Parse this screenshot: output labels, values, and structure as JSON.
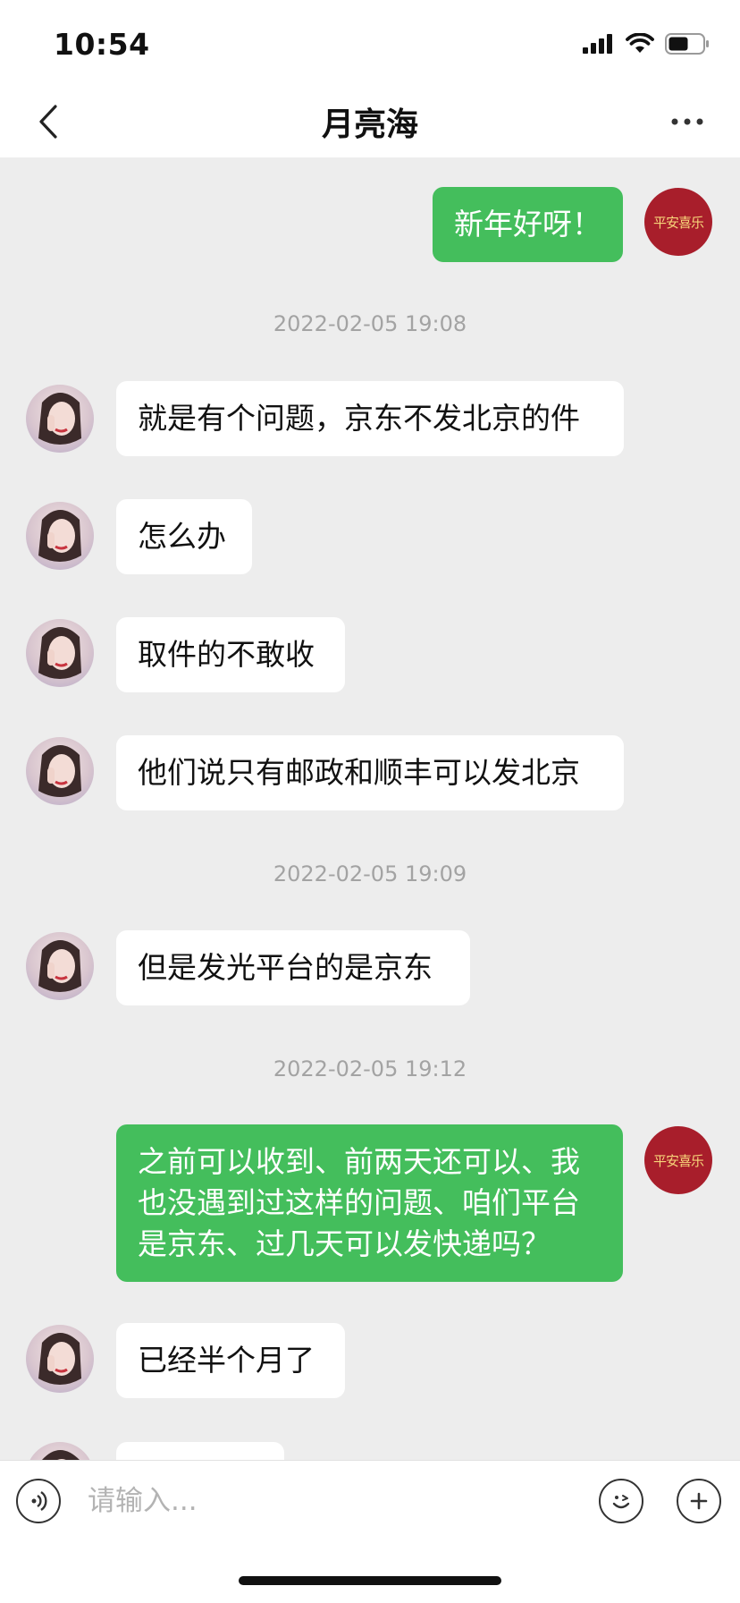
{
  "status_bar": {
    "time": "10:54"
  },
  "header": {
    "title": "月亮海"
  },
  "self_avatar_text": "平安喜乐",
  "messages": [
    {
      "type": "out",
      "text": "新年好呀！"
    },
    {
      "type": "time",
      "text": "2022-02-05 19:08"
    },
    {
      "type": "in",
      "text": "就是有个问题，京东不发北京的件"
    },
    {
      "type": "in",
      "text": "怎么办"
    },
    {
      "type": "in",
      "text": "取件的不敢收"
    },
    {
      "type": "in",
      "text": "他们说只有邮政和顺丰可以发北京"
    },
    {
      "type": "time",
      "text": "2022-02-05 19:09"
    },
    {
      "type": "in",
      "text": "但是发光平台的是京东"
    },
    {
      "type": "time",
      "text": "2022-02-05 19:12"
    },
    {
      "type": "out",
      "text": "之前可以收到、前两天还可以、我也没遇到过这样的问题、咱们平台是京东、过几天可以发快递吗？"
    },
    {
      "type": "in",
      "text": "已经半个月了"
    },
    {
      "type": "in",
      "text": ""
    }
  ],
  "input": {
    "placeholder": "请输入..."
  }
}
